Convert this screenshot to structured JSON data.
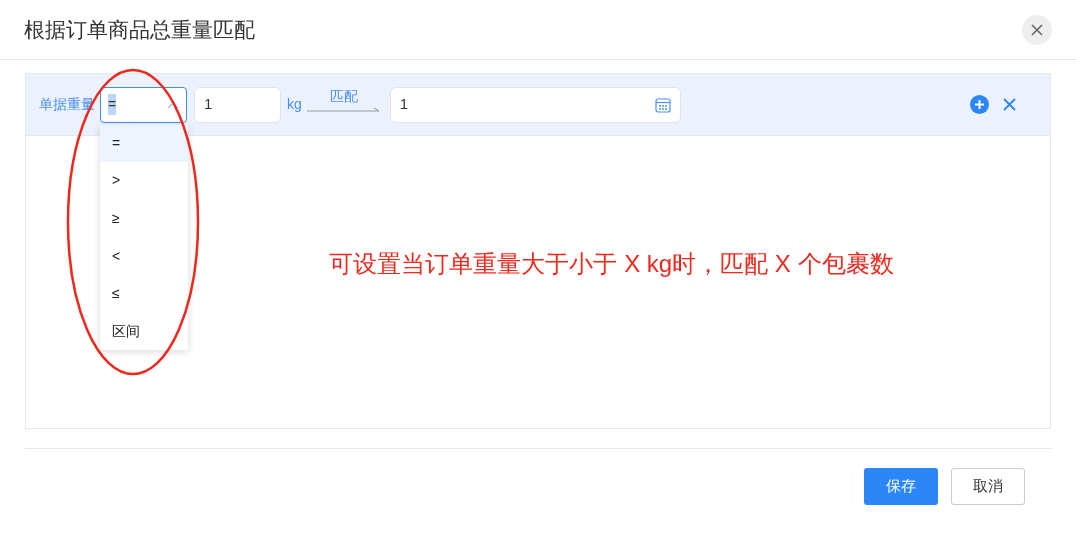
{
  "dialog": {
    "title": "根据订单商品总重量匹配"
  },
  "rule": {
    "label": "单据重量",
    "operator": {
      "value": "=",
      "expanded": true,
      "options": [
        {
          "label": "=",
          "selected": true
        },
        {
          "label": ">",
          "selected": false
        },
        {
          "label": "≥",
          "selected": false
        },
        {
          "label": "<",
          "selected": false
        },
        {
          "label": "≤",
          "selected": false
        },
        {
          "label": "区间",
          "selected": false
        }
      ]
    },
    "weight": "1",
    "unit": "kg",
    "arrow_label": "匹配",
    "count": "1"
  },
  "annotation": "可设置当订单重量大于小于 X kg时，匹配 X 个包裹数",
  "buttons": [
    {
      "label": "保存",
      "kind": "primary"
    },
    {
      "label": "取消",
      "kind": "default"
    }
  ]
}
